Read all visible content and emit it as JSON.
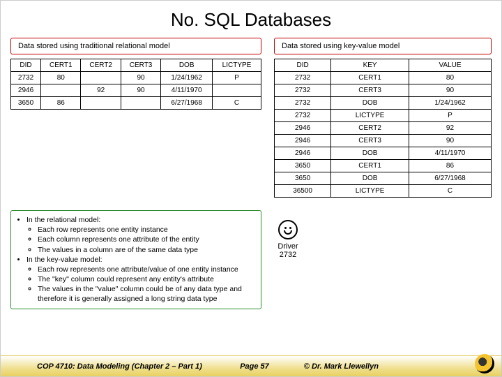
{
  "title": "No. SQL Databases",
  "labels": {
    "left": "Data stored using traditional relational model",
    "right": "Data stored using key-value model"
  },
  "rel_table": {
    "headers": [
      "DID",
      "CERT1",
      "CERT2",
      "CERT3",
      "DOB",
      "LICTYPE"
    ],
    "rows": [
      [
        "2732",
        "80",
        "",
        "90",
        "1/24/1962",
        "P"
      ],
      [
        "2946",
        "",
        "92",
        "90",
        "4/11/1970",
        ""
      ],
      [
        "3650",
        "86",
        "",
        "",
        "6/27/1968",
        "C"
      ]
    ]
  },
  "kv_table": {
    "headers": [
      "DID",
      "KEY",
      "VALUE"
    ],
    "rows": [
      [
        "2732",
        "CERT1",
        "80"
      ],
      [
        "2732",
        "CERT3",
        "90"
      ],
      [
        "2732",
        "DOB",
        "1/24/1962"
      ],
      [
        "2732",
        "LICTYPE",
        "P"
      ],
      [
        "2946",
        "CERT2",
        "92"
      ],
      [
        "2946",
        "CERT3",
        "90"
      ],
      [
        "2946",
        "DOB",
        "4/11/1970"
      ],
      [
        "3650",
        "CERT1",
        "86"
      ],
      [
        "3650",
        "DOB",
        "6/27/1968"
      ],
      [
        "36500",
        "LICTYPE",
        "C"
      ]
    ]
  },
  "explain": {
    "b1": "In the relational model:",
    "b1a": "Each row represents one entity instance",
    "b1b": "Each column represents one attribute of the entity",
    "b1c": "The values in a column are of the same data type",
    "b2": "In the key-value model:",
    "b2a": "Each row represents one attribute/value of one entity instance",
    "b2b": "The \"key\" column could represent any entity's attribute",
    "b2c": "The values in the \"value\" column could be of any data type and therefore it is generally assigned a long string data type"
  },
  "smiley": {
    "line1": "Driver",
    "line2": "2732"
  },
  "footer": {
    "left": "COP 4710: Data Modeling (Chapter 2 – Part 1)",
    "mid": "Page 57",
    "right": "© Dr. Mark Llewellyn"
  }
}
